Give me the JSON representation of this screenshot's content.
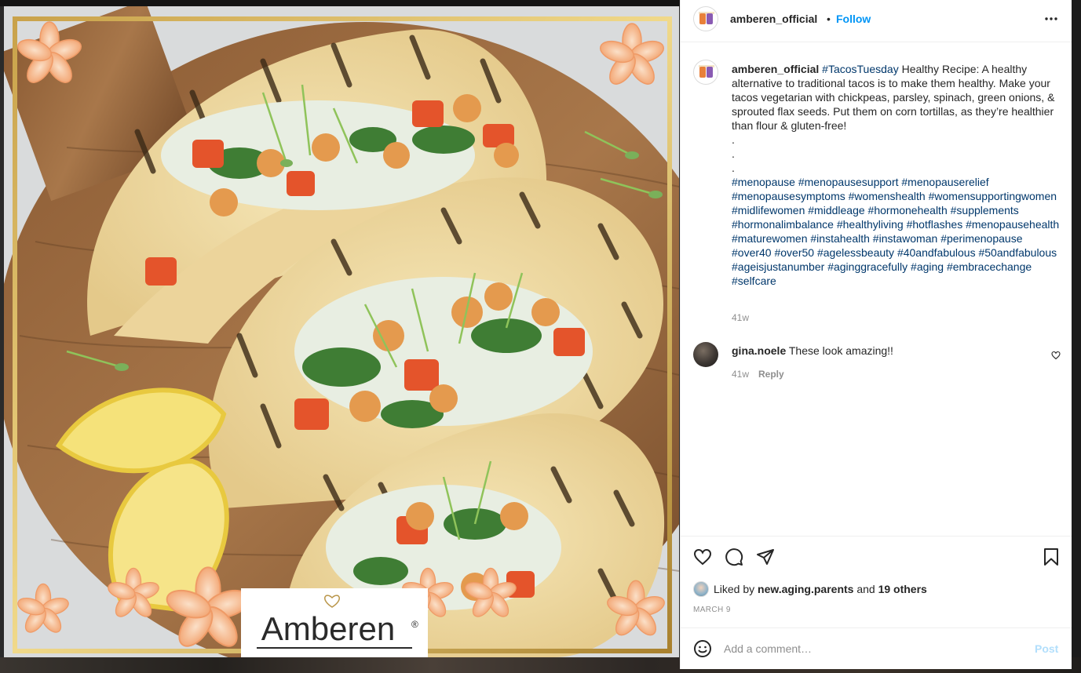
{
  "post": {
    "username": "amberen_official",
    "follow_label": "Follow",
    "separator": "•",
    "more_label": "•••",
    "image_brand_text": "Amberen",
    "image_brand_mark": "®"
  },
  "caption": {
    "username": "amberen_official",
    "hashtag_lead": "#TacosTuesday",
    "text": " Healthy Recipe: A healthy alternative to traditional tacos is to make them healthy. Make your tacos vegetarian with chickpeas, parsley, spinach, green onions, & sprouted flax seeds. Put them on corn tortillas, as they’re healthier than flour & gluten-free!",
    "dots": [
      ".",
      ".",
      "."
    ],
    "hashtags": [
      "#menopause",
      "#menopausesupport",
      "#menopauserelief",
      "#menopausesymptoms",
      "#womenshealth",
      "#womensupportingwomen",
      "#midlifewomen",
      "#middleage",
      "#hormonehealth",
      "#supplements",
      "#hormonalimbalance",
      "#healthyliving",
      "#hotflashes",
      "#menopausehealth",
      "#maturewomen",
      "#instahealth",
      "#instawoman",
      "#perimenopause",
      "#over40",
      "#over50",
      "#agelessbeauty",
      "#40andfabulous",
      "#50andfabulous",
      "#ageisjustanumber",
      "#aginggracefully",
      "#aging",
      "#embracechange",
      "#selfcare"
    ],
    "time": "41w"
  },
  "comments": [
    {
      "username": "gina.noele",
      "text": "These look amazing!!",
      "time": "41w",
      "reply_label": "Reply"
    }
  ],
  "likes": {
    "prefix": "Liked by",
    "user": "new.aging.parents",
    "joiner": "and",
    "others": "19 others"
  },
  "date": "MARCH 9",
  "add_comment": {
    "placeholder": "Add a comment…",
    "post_label": "Post"
  },
  "icons": [
    "kebab-more-icon",
    "heart-icon",
    "comment-icon",
    "share-icon",
    "bookmark-icon",
    "emoji-icon",
    "small-heart-icon"
  ],
  "colors": {
    "link_blue": "#0095f6",
    "hashtag_blue": "#00376b",
    "muted": "#8e8e8e",
    "post_disabled": "#b2dffc"
  }
}
